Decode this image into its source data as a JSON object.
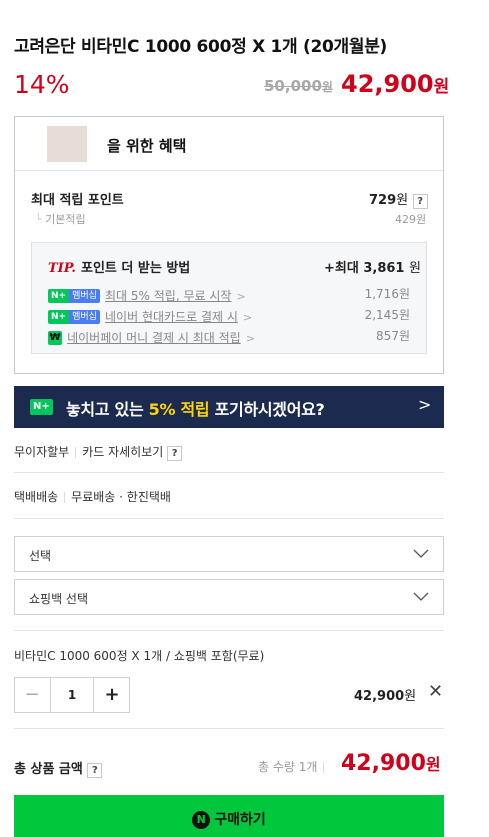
{
  "product": {
    "title": "고려은단 비타민C 1000 600정 X 1개 (20개월분)",
    "discount": "14%",
    "original_price": "50,000",
    "original_unit": "원",
    "sale_price": "42,900",
    "sale_unit": "원"
  },
  "benefits": {
    "header": "을 위한 혜택",
    "max_points_label": "최대 적립 포인트",
    "max_points_value": "729",
    "max_points_unit": "원",
    "help": "?",
    "basic_label": "기본적립",
    "basic_value": "429원",
    "tip_label": "TIP.",
    "tip_text": "포인트 더 받는 방법",
    "tip_max": "+최대 3,861",
    "tip_max_unit": "원",
    "tips": [
      {
        "badge_n": "N+",
        "badge_m": "멤버십",
        "text": "최대 5% 적립, 무료 시작",
        "value": "1,716원"
      },
      {
        "badge_n": "N+",
        "badge_m": "멤버십",
        "text": "네이버 현대카드로 결제 시",
        "value": "2,145원"
      },
      {
        "badge_n": "₩",
        "badge_m": "",
        "text": "네이버페이 머니 결제 시 최대 적립",
        "value": "857원"
      }
    ],
    "chev": ">"
  },
  "banner": {
    "badge": "N+",
    "text_before": "놓치고 있는 ",
    "highlight": "5% 적립",
    "text_after": " 포기하시겠어요?",
    "chev": ">"
  },
  "installment": {
    "label": "무이자할부",
    "link": "카드 자세히보기",
    "help": "?"
  },
  "delivery": {
    "type": "택배배송",
    "fee": "무료배송",
    "carrier": "· 한진택배"
  },
  "selects": [
    {
      "label": "선택"
    },
    {
      "label": "쇼핑백 선택"
    }
  ],
  "option": {
    "name": "비타민C 1000 600정 X 1개 / 쇼핑백 포함(무료)",
    "minus": "−",
    "qty": "1",
    "plus": "+",
    "price": "42,900",
    "unit": "원",
    "remove": "✕"
  },
  "total": {
    "label": "총 상품 금액",
    "help": "?",
    "qty_text": "총 수량 1개",
    "price": "42,900",
    "unit": "원"
  },
  "buy": {
    "icon": "N",
    "label": "구매하기"
  },
  "colors": {
    "accent_red": "#d0021b",
    "naver_green": "#00c73c",
    "banner_navy": "#1d2a4f",
    "highlight_yellow": "#ffd700"
  }
}
